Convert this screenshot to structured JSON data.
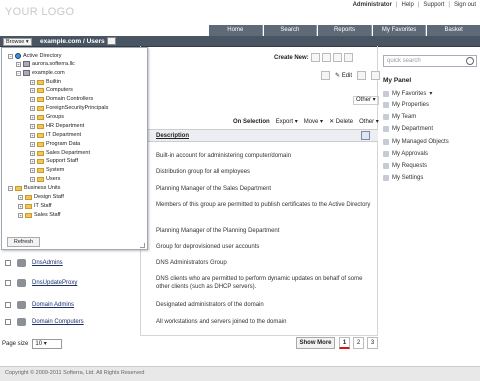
{
  "logo": "YOUR LOGO",
  "top_links": {
    "user": "Administrator",
    "help": "Help",
    "support": "Support",
    "signout": "Sign out",
    "sep": "|"
  },
  "nav": [
    "Home",
    "Search",
    "Reports",
    "My Favorites",
    "Basket"
  ],
  "browse": {
    "label": "Browse",
    "breadcrumb": "example.com / Users"
  },
  "tree": {
    "root": "Active Directory",
    "aurora": "aurora.softerra.llc",
    "example": "example.com",
    "children": [
      "Builtin",
      "Computers",
      "Domain Controllers",
      "ForeignSecurityPrincipals",
      "Groups",
      "HR Department",
      "IT Department",
      "Program Data",
      "Sales Department",
      "Support Staff",
      "System",
      "Users"
    ],
    "bu": "Business Units",
    "bu_children": [
      "Design Staff",
      "IT Staff",
      "Sales Staff"
    ],
    "refresh": "Refresh"
  },
  "create_new": "Create New:",
  "toolbar": {
    "edit": "Edit",
    "other": "Other"
  },
  "selection": {
    "label": "On Selection",
    "export": "Export",
    "move": "Move",
    "delete": "Delete",
    "other": "Other"
  },
  "columns": {
    "description": "Description"
  },
  "descriptions": [
    "Built-in account for administering computer/domain",
    "Distribution group for all employees",
    "Planning Manager of the Sales Department",
    "Members of this group are permitted to publish certificates to the Active Directory",
    "Planning Manager of the Planning Department",
    "Group for deprovisioned user accounts",
    "DNS Administrators Group",
    "DNS clients who are permitted to perform dynamic updates on behalf of some other clients (such as DHCP servers).",
    "Designated administrators of the domain",
    "All workstations and servers joined to the domain"
  ],
  "rows": [
    "DnsAdmins",
    "DnsUpdateProxy",
    "Domain Admins",
    "Domain Computers"
  ],
  "search": {
    "placeholder": "quick search"
  },
  "my_panel": {
    "title": "My Panel",
    "items": [
      "My Favorites",
      "My Properties",
      "My Team",
      "My Department",
      "My Managed Objects",
      "My Approvals",
      "My Requests",
      "My Settings"
    ]
  },
  "paging": {
    "label": "Page size",
    "size": "10",
    "show_more": "Show More",
    "pages": [
      "1",
      "2",
      "3"
    ]
  },
  "footer": "Copyright © 2009-2011 Softerra, Ltd. All Rights Reserved"
}
